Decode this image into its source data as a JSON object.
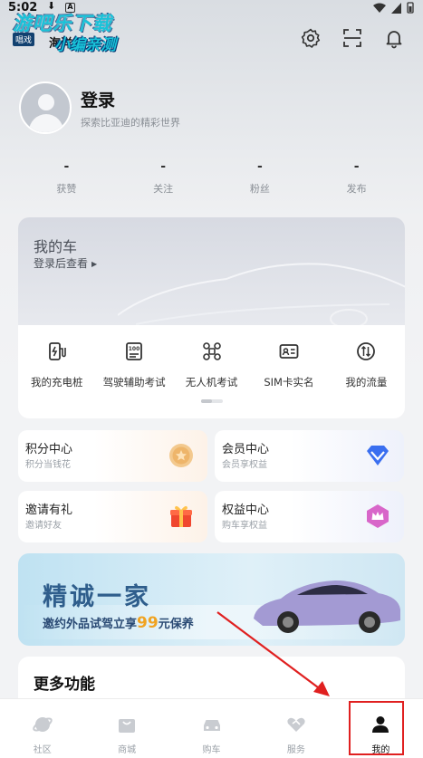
{
  "status_bar": {
    "time": "5:02",
    "download_glyph": "⬇",
    "app_letter": "A"
  },
  "watermark": {
    "line1": "游吧乐下载",
    "line2": "小编亲测",
    "chip": "唱戏",
    "sea": "海洋"
  },
  "profile": {
    "name": "登录",
    "subtitle": "探索比亚迪的精彩世界"
  },
  "stats": [
    {
      "value": "-",
      "label": "获赞"
    },
    {
      "value": "-",
      "label": "关注"
    },
    {
      "value": "-",
      "label": "粉丝"
    },
    {
      "value": "-",
      "label": "发布"
    }
  ],
  "my_car": {
    "title": "我的车",
    "link": "登录后查看",
    "link_glyph": "▶"
  },
  "quick_links": [
    {
      "label": "我的充电桩",
      "icon": "charging-pile-icon"
    },
    {
      "label": "驾驶辅助考试",
      "icon": "exam-document-icon"
    },
    {
      "label": "无人机考试",
      "icon": "drone-icon"
    },
    {
      "label": "SIM卡实名",
      "icon": "id-card-icon"
    },
    {
      "label": "我的流量",
      "icon": "data-flow-icon"
    }
  ],
  "tiles": [
    {
      "title": "积分中心",
      "sub": "积分当钱花",
      "icon": "points-coin-icon"
    },
    {
      "title": "会员中心",
      "sub": "会员享权益",
      "icon": "diamond-icon"
    },
    {
      "title": "邀请有礼",
      "sub": "邀请好友",
      "icon": "gift-box-icon"
    },
    {
      "title": "权益中心",
      "sub": "购车享权益",
      "icon": "crown-badge-icon"
    }
  ],
  "promo": {
    "headline": "精诚一家",
    "pre": "邀约外品试驾立享",
    "amount": "99",
    "post": "元保养"
  },
  "more": {
    "title": "更多功能"
  },
  "tabs": [
    {
      "label": "社区",
      "icon": "planet-icon",
      "active": false
    },
    {
      "label": "商城",
      "icon": "shopping-bag-icon",
      "active": false
    },
    {
      "label": "购车",
      "icon": "car-icon",
      "active": false
    },
    {
      "label": "服务",
      "icon": "handshake-icon",
      "active": false
    },
    {
      "label": "我的",
      "icon": "person-icon",
      "active": true
    }
  ],
  "colors": {
    "accent": "#111111",
    "annotation": "#e02020",
    "promo_text": "#2f5e8c",
    "promo_amount": "#f0a321"
  }
}
